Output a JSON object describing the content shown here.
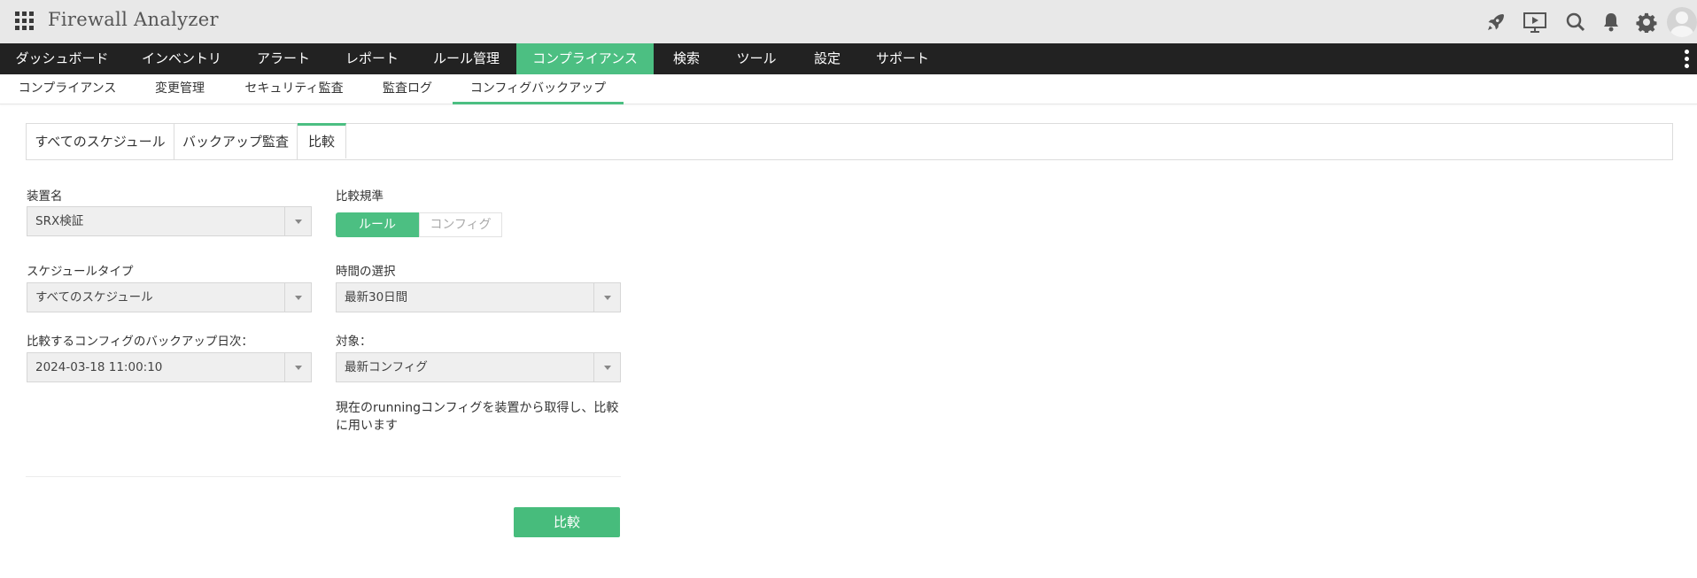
{
  "header": {
    "title": "Firewall Analyzer",
    "icons": [
      "apps-icon",
      "rocket-icon",
      "presentation-icon",
      "search-icon",
      "bell-icon",
      "gear-icon",
      "avatar"
    ]
  },
  "main_nav": {
    "items": [
      "ダッシュボード",
      "インベントリ",
      "アラート",
      "レポート",
      "ルール管理",
      "コンプライアンス",
      "検索",
      "ツール",
      "設定",
      "サポート"
    ],
    "active": "コンプライアンス"
  },
  "sub_nav": {
    "items": [
      "コンプライアンス",
      "変更管理",
      "セキュリティ監査",
      "監査ログ",
      "コンフィグバックアップ"
    ],
    "active": "コンフィグバックアップ"
  },
  "tabs": {
    "items": [
      "すべてのスケジュール",
      "バックアップ監査",
      "比較"
    ],
    "active": "比較"
  },
  "form": {
    "device_label": "装置名",
    "device_value": "SRX検証",
    "criteria_label": "比較規準",
    "toggle_rule": "ルール",
    "toggle_config": "コンフィグ",
    "schedule_type_label": "スケジュールタイプ",
    "schedule_type_value": "すべてのスケジュール",
    "time_label": "時間の選択",
    "time_value": "最新30日間",
    "backup_date_label": "比較するコンフィグのバックアップ日次：",
    "backup_date_value": "2024-03-18 11:00:10",
    "target_label": "対象：",
    "target_value": "最新コンフィグ",
    "note": "現在のrunningコンフィグを装置から取得し、比較に用います",
    "compare_button": "比較"
  },
  "colors": {
    "accent": "#4cbf82",
    "nav_bg": "#222222",
    "header_bg": "#e8e8e8"
  }
}
